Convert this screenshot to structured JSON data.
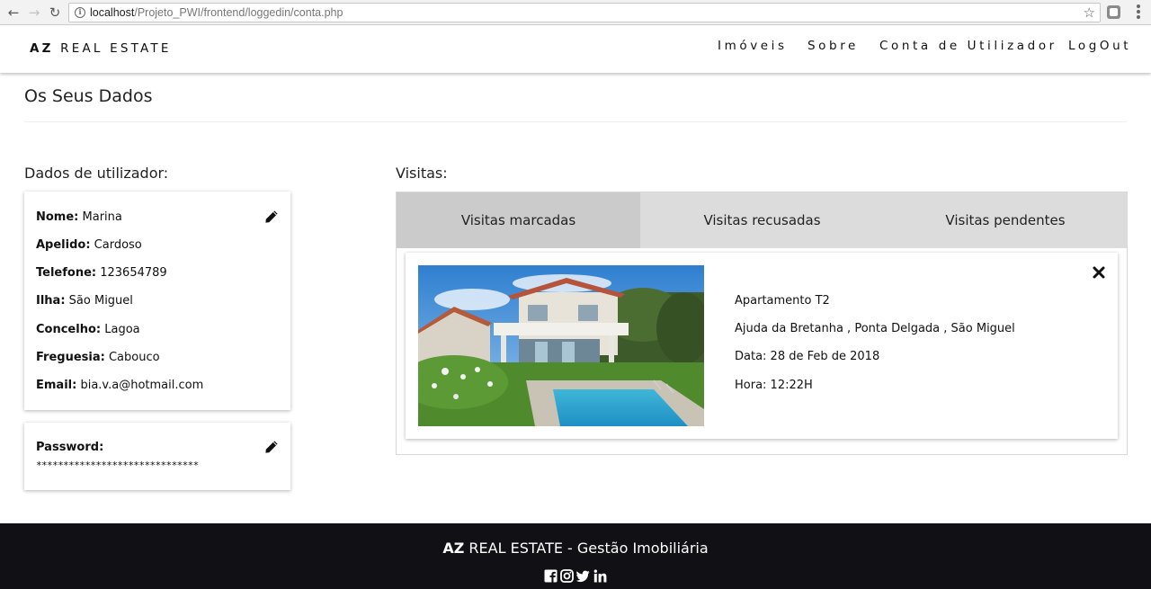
{
  "browser": {
    "url_host": "localhost",
    "url_path": "/Projeto_PWI/frontend/loggedin/conta.php",
    "icons": [
      "back-icon",
      "forward-icon",
      "reload-icon",
      "info-icon",
      "star-icon",
      "extension-icon",
      "menu-icon"
    ]
  },
  "nav": {
    "brand_bold": "AZ",
    "brand_rest": "REAL ESTATE",
    "links": [
      "Imóveis",
      "Sobre",
      "Conta de Utilizador",
      "LogOut"
    ]
  },
  "page": {
    "title": "Os Seus Dados"
  },
  "user_section": {
    "heading": "Dados de utilizador:",
    "fields": [
      {
        "label": "Nome:",
        "value": "Marina"
      },
      {
        "label": "Apelido:",
        "value": "Cardoso"
      },
      {
        "label": "Telefone:",
        "value": "123654789"
      },
      {
        "label": "Ilha:",
        "value": "São Miguel"
      },
      {
        "label": "Concelho:",
        "value": "Lagoa"
      },
      {
        "label": "Freguesia:",
        "value": "Cabouco"
      },
      {
        "label": "Email:",
        "value": "bia.v.a@hotmail.com"
      }
    ],
    "password_label": "Password:",
    "password_value": "******************************"
  },
  "visits": {
    "heading": "Visitas:",
    "tabs": [
      "Visitas marcadas",
      "Visitas recusadas",
      "Visitas pendentes"
    ],
    "active_tab": "Visitas marcadas",
    "items": [
      {
        "title": "Apartamento T2",
        "location": "Ajuda da Bretanha , Ponta Delgada , São Miguel",
        "date": "Data: 28 de Feb de 2018",
        "time": "Hora: 12:22H"
      }
    ]
  },
  "footer": {
    "brand_bold": "AZ",
    "brand_rest": "REAL ESTATE - Gestão Imobiliária",
    "social_icons": [
      "facebook-icon",
      "instagram-icon",
      "twitter-icon",
      "linkedin-icon"
    ]
  },
  "colors": {
    "footer_bg": "#111115",
    "tab_active": "#cbcbcb",
    "tab_inactive": "#dcdcdc"
  }
}
